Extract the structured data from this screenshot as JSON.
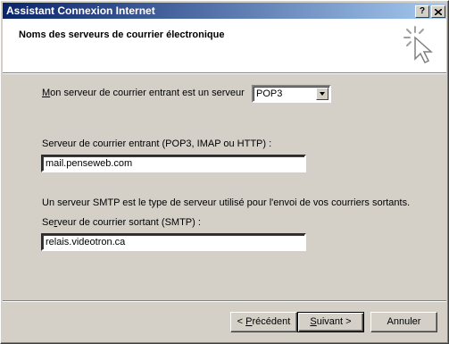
{
  "window": {
    "title": "Assistant Connexion Internet",
    "help_button": "?",
    "close_button": "✕"
  },
  "header": {
    "title": "Noms des serveurs de courrier électronique",
    "icon": "wizard-sparkle-cursor-icon"
  },
  "incoming_type": {
    "label_prefix": "",
    "label_accel": "M",
    "label_rest": "on serveur de courrier entrant est un serveur",
    "selected": "POP3"
  },
  "incoming_server": {
    "label": "Serveur de courrier entrant (POP3, IMAP ou HTTP) :",
    "label_accel": "e",
    "value": "mail.penseweb.com"
  },
  "smtp_info": "Un serveur SMTP est le type de serveur utilisé pour l'envoi de vos courriers sortants.",
  "outgoing_server": {
    "label_prefix": "Se",
    "label_accel": "r",
    "label_rest": "veur de courrier sortant (SMTP) :",
    "value": "relais.videotron.ca"
  },
  "buttons": {
    "back_prefix": "< ",
    "back_accel": "P",
    "back_rest": "récédent",
    "next_accel": "S",
    "next_rest": "uivant >",
    "cancel": "Annuler"
  },
  "colors": {
    "titlebar_start": "#0a246a",
    "titlebar_end": "#a6caf0",
    "face": "#d4d0c8"
  }
}
